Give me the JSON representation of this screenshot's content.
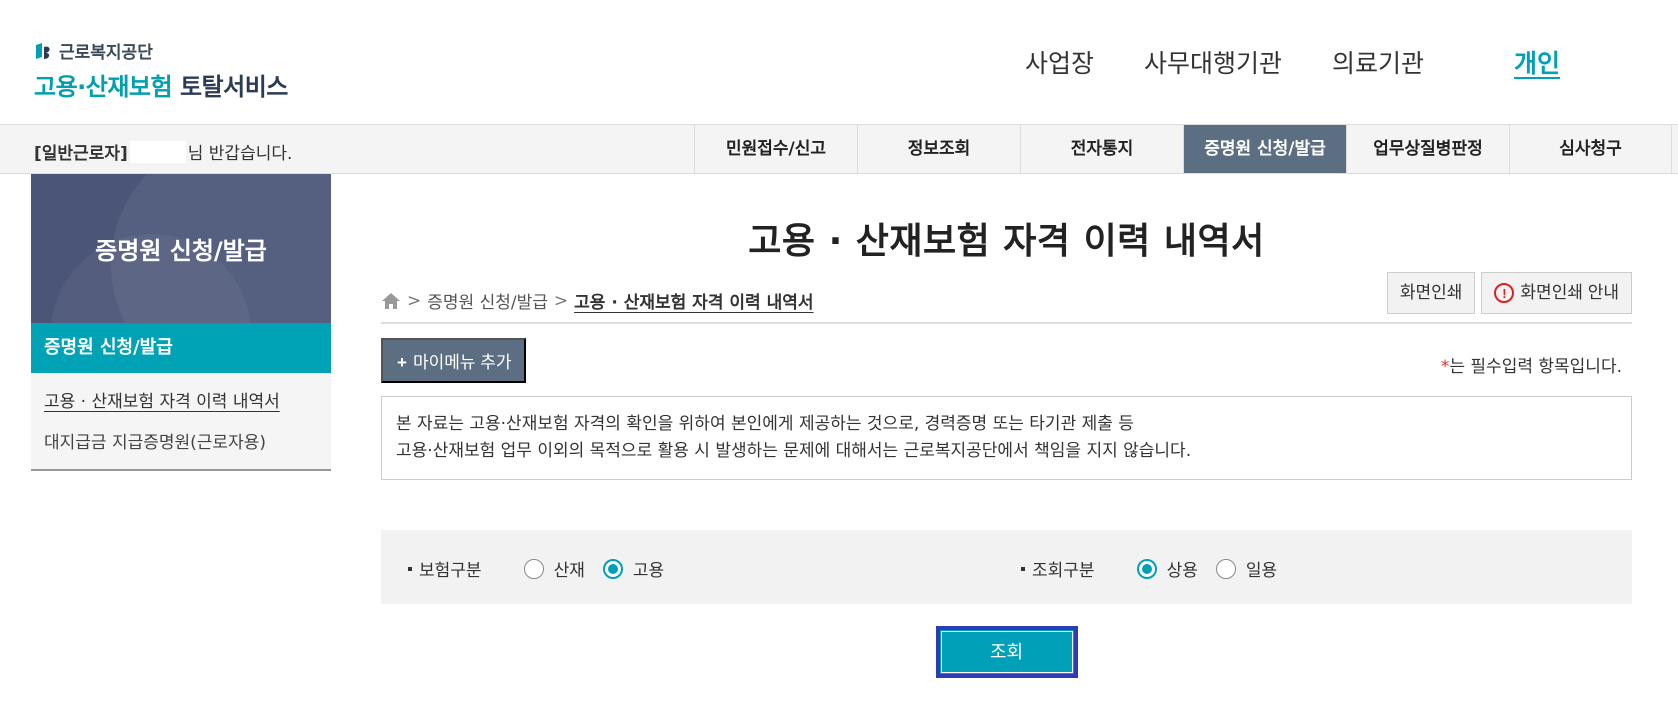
{
  "header": {
    "logo_org": "근로복지공단",
    "logo_service_part1": "고용·산재보험",
    "logo_service_part2": "토탈서비스",
    "nav": [
      {
        "label": "사업장"
      },
      {
        "label": "사무대행기관"
      },
      {
        "label": "의료기관"
      },
      {
        "label": "개인"
      }
    ]
  },
  "gnb": {
    "greeting_usertype": "[일반근로자]",
    "greeting_suffix": "님 반갑습니다.",
    "menu": [
      {
        "label": "민원접수/신고"
      },
      {
        "label": "정보조회"
      },
      {
        "label": "전자통지"
      },
      {
        "label": "증명원 신청/발급"
      },
      {
        "label": "업무상질병판정"
      },
      {
        "label": "심사청구"
      }
    ]
  },
  "sidebar": {
    "banner_title": "증명원 신청/발급",
    "category": "증명원 신청/발급",
    "items": [
      {
        "label": "고용 · 산재보험 자격 이력 내역서"
      },
      {
        "label": "대지급금 지급증명원(근로자용)"
      }
    ]
  },
  "main": {
    "title": "고용 · 산재보험 자격 이력 내역서",
    "breadcrumb": {
      "sep": ">",
      "level1": "증명원 신청/발급",
      "current": "고용 · 산재보험 자격 이력 내역서"
    },
    "print_button": "화면인쇄",
    "print_guide_button": "화면인쇄 안내",
    "mymenu_plus": "+",
    "mymenu_button": "마이메뉴 추가",
    "required_star": "*",
    "required_note": "는 필수입력 항목입니다.",
    "notice_line1": "본 자료는 고용·산재보험 자격의 확인을 위하여 본인에게 제공하는 것으로, 경력증명 또는 타기관 제출 등",
    "notice_line2": "고용·산재보험 업무 이외의 목적으로 활용 시 발생하는 문제에 대해서는 근로복지공단에서 책임을 지지 않습니다.",
    "search": {
      "insurance_label": "보험구분",
      "insurance_options": [
        {
          "label": "산재",
          "selected": false
        },
        {
          "label": "고용",
          "selected": true
        }
      ],
      "inquiry_label": "조회구분",
      "inquiry_options": [
        {
          "label": "상용",
          "selected": true
        },
        {
          "label": "일용",
          "selected": false
        }
      ]
    },
    "query_button": "조회"
  },
  "colors": {
    "accent_teal": "#00a0b8",
    "active_menu_bg": "#5b6e82",
    "sidebar_banner": "#4b5577",
    "focus_border": "#2a3db5"
  }
}
